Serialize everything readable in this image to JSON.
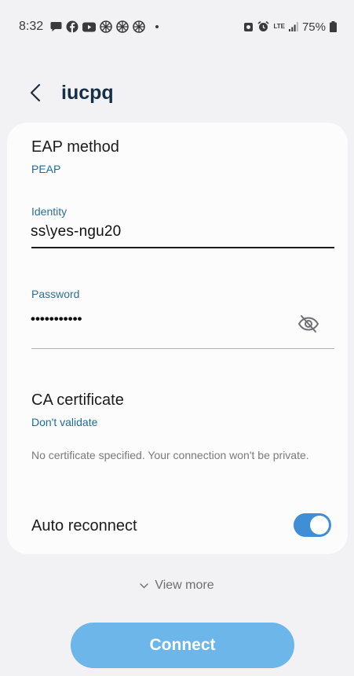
{
  "status_bar": {
    "time": "8:32",
    "lte": "LTE",
    "battery": "75%",
    "icons": [
      "chat-bubble-icon",
      "facebook-icon",
      "youtube-icon",
      "app-icon",
      "app-icon",
      "app-icon",
      "dot-icon",
      "alarm-lock-icon",
      "alarm-icon",
      "lte-icon",
      "signal-icon",
      "battery-icon"
    ]
  },
  "header": {
    "title": "iucpq",
    "back_icon": "chevron-left-icon"
  },
  "eap": {
    "title": "EAP method",
    "value": "PEAP"
  },
  "identity": {
    "label": "Identity",
    "value": "ss\\yes-ngu20"
  },
  "password": {
    "label": "Password",
    "value": "•••••••••••",
    "visibility_icon": "eye-off-icon"
  },
  "ca_certificate": {
    "title": "CA certificate",
    "value": "Don't validate",
    "note": "No certificate specified. Your connection won't be private."
  },
  "auto_reconnect": {
    "label": "Auto reconnect",
    "enabled": true
  },
  "view_more": {
    "label": "View more",
    "icon": "chevron-down-icon"
  },
  "connect": {
    "label": "Connect"
  },
  "colors": {
    "background": "#f2f2f4",
    "card": "#fcfcfc",
    "title": "#153046",
    "accent_text": "#1d6a9c",
    "toggle": "#3f8fd6",
    "connect_button": "#6cb6ea"
  }
}
